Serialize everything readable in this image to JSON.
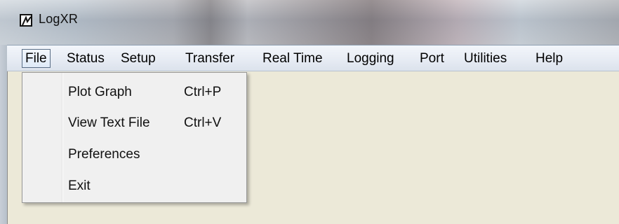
{
  "window": {
    "title": "LogXR",
    "icon": "app-logo-icon"
  },
  "menubar": {
    "items": [
      {
        "label": "File"
      },
      {
        "label": "Status"
      },
      {
        "label": "Setup"
      },
      {
        "label": "Transfer"
      },
      {
        "label": "Real Time"
      },
      {
        "label": "Logging"
      },
      {
        "label": "Port"
      },
      {
        "label": "Utilities"
      },
      {
        "label": "Help"
      }
    ]
  },
  "file_menu": {
    "items": [
      {
        "label": "Plot Graph",
        "shortcut": "Ctrl+P"
      },
      {
        "label": "View Text File",
        "shortcut": "Ctrl+V"
      },
      {
        "label": "Preferences",
        "shortcut": ""
      },
      {
        "label": "Exit",
        "shortcut": ""
      }
    ]
  }
}
